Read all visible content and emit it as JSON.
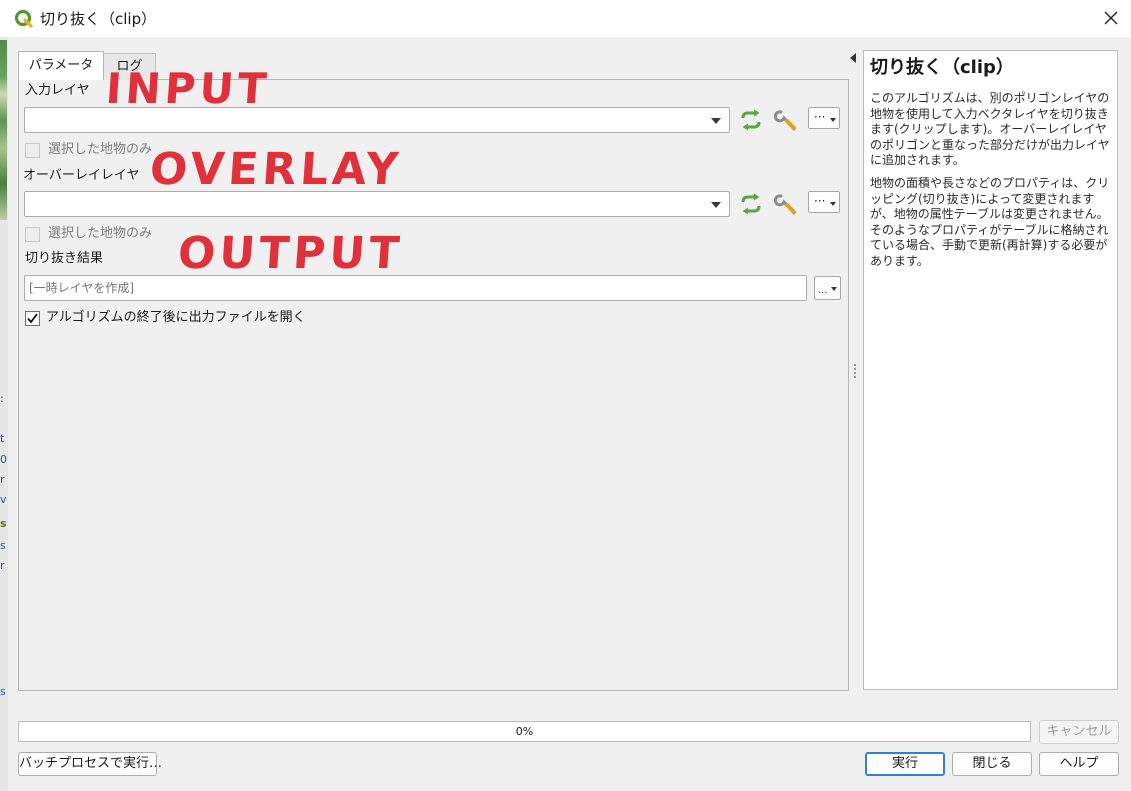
{
  "window": {
    "title": "切り抜く（clip）"
  },
  "tabs": [
    {
      "label": "パラメータ",
      "active": true
    },
    {
      "label": "ログ",
      "active": false
    }
  ],
  "params": {
    "input_layer": {
      "label": "入力レイヤ",
      "value": "",
      "selected_only_label": "選択した地物のみ",
      "selected_only_checked": false
    },
    "overlay_layer": {
      "label": "オーバーレイレイヤ",
      "value": "",
      "selected_only_label": "選択した地物のみ",
      "selected_only_checked": false
    },
    "output": {
      "label": "切り抜き結果",
      "placeholder": "[一時レイヤを作成]",
      "open_after_label": "アルゴリズムの終了後に出力ファイルを開く",
      "open_after_checked": true
    },
    "dots": "···"
  },
  "annotations": {
    "input": "INPUT",
    "overlay": "OVERLAY",
    "output": "OUTPUT",
    "color": "#e0303a"
  },
  "help": {
    "title": "切り抜く（clip）",
    "paragraphs": [
      "このアルゴリズムは、別のポリゴンレイヤの地物を使用して入力ベクタレイヤを切り抜きます(クリップします)。オーバーレイレイヤのポリゴンと重なった部分だけが出力レイヤに追加されます。",
      "地物の面積や長さなどのプロパティは、クリッピング(切り抜き)によって変更されますが、地物の属性テーブルは変更されません。そのようなプロパティがテーブルに格納されている場合、手動で更新(再計算)する必要があります。"
    ]
  },
  "footer": {
    "progress_percent": 0,
    "progress_text": "0%",
    "cancel_label": "キャンセル",
    "batch_label": "バッチプロセスで実行…",
    "run_label": "実行",
    "close_label": "閉じる",
    "help_label": "ヘルプ"
  },
  "background_fragments": [
    ":",
    "t",
    "0",
    "r",
    "v",
    "s",
    "s",
    "r",
    "s"
  ],
  "colors": {
    "accent": "#2f7ed8",
    "qgis_green": "#589632"
  },
  "icons": {
    "title": "qgis-logo-icon",
    "close": "close-icon",
    "iterate": "iterate-layer-icon",
    "advanced": "wrench-icon"
  }
}
